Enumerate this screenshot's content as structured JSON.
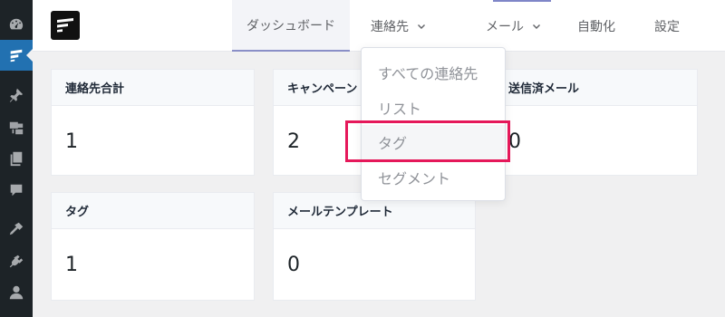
{
  "nav": {
    "dashboard": "ダッシュボード",
    "contacts": "連絡先",
    "email": "メール",
    "automation": "自動化",
    "settings": "設定"
  },
  "contacts_dropdown": {
    "items": [
      "すべての連絡先",
      "リスト",
      "タグ",
      "セグメント"
    ],
    "highlighted": "タグ"
  },
  "cards": [
    {
      "title": "連絡先合計",
      "value": "1"
    },
    {
      "title": "キャンペーン",
      "value": "2"
    },
    {
      "title": "送信済メール",
      "value": "0"
    },
    {
      "title": "タグ",
      "value": "1"
    },
    {
      "title": "メールテンプレート",
      "value": "0"
    }
  ],
  "colors": {
    "sidebar_bg": "#1d2327",
    "sidebar_active": "#2271b1",
    "highlight": "#e5185a",
    "nav_active_underline": "#8a8fc7"
  },
  "icons": {
    "sidebar": [
      "dashboard-icon",
      "fluentcrm-icon",
      "pin-icon",
      "media-icon",
      "pages-icon",
      "comments-icon",
      "appearance-icon",
      "plugins-icon",
      "users-icon"
    ]
  }
}
